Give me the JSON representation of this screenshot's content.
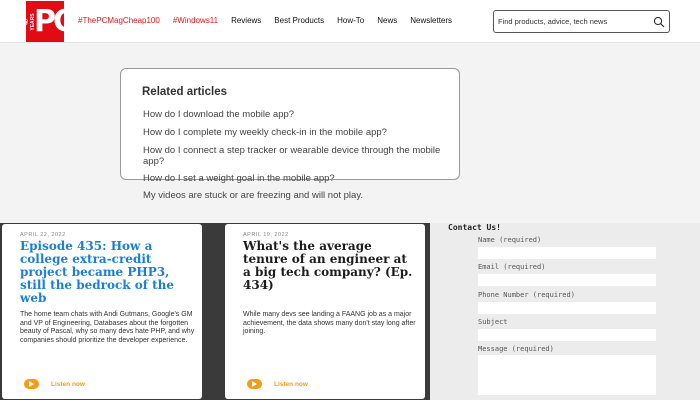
{
  "header": {
    "logo": {
      "text": "PC",
      "years": "40 YEARS"
    },
    "nav": [
      {
        "label": "#ThePCMagCheap100",
        "accent": true
      },
      {
        "label": "#Windows11",
        "accent": true
      },
      {
        "label": "Reviews",
        "accent": false
      },
      {
        "label": "Best Products",
        "accent": false
      },
      {
        "label": "How-To",
        "accent": false
      },
      {
        "label": "News",
        "accent": false
      },
      {
        "label": "Newsletters",
        "accent": false
      }
    ],
    "search": {
      "placeholder": "Find products, advice, tech news",
      "icon": "magnifier-icon"
    }
  },
  "related": {
    "title": "Related articles",
    "items": [
      "How do I download the mobile app?",
      "How do I complete my weekly check-in in the mobile app?",
      "How do I connect a step tracker or wearable device through the mobile app?",
      "How do I set a weight goal in the mobile app?",
      "My videos are stuck or are freezing and will not play."
    ]
  },
  "episodes": [
    {
      "date": "APRIL 22, 2022",
      "title": "Episode 435: How a college extra-credit project became PHP3, still the bedrock of the web",
      "description": "The home team chats with Andi Gutmans, Google's GM and VP of Engineering, Databases about the forgotten beauty of Pascal, why so many devs hate PHP, and why companies should prioritize the developer experience.",
      "listen": "Listen now",
      "title_color": "#1a7fd6"
    },
    {
      "date": "APRIL 19, 2022",
      "title": "What's the average tenure of an engineer at a big tech company? (Ep. 434)",
      "description": "While many devs see landing a FAANG job as a major achievement, the data shows many don't stay long after joining.",
      "listen": "Listen now",
      "title_color": "#1c1c1c"
    }
  ],
  "contact": {
    "title": "Contact Us!",
    "fields": [
      {
        "label": "Name (required)"
      },
      {
        "label": "Email (required)"
      },
      {
        "label": "Phone Number (required)"
      },
      {
        "label": "Subject"
      }
    ],
    "message_label": "Message (required)"
  },
  "colors": {
    "brand": "#e20a13",
    "accent": "#d81b20",
    "listen": "#f49b1a"
  }
}
